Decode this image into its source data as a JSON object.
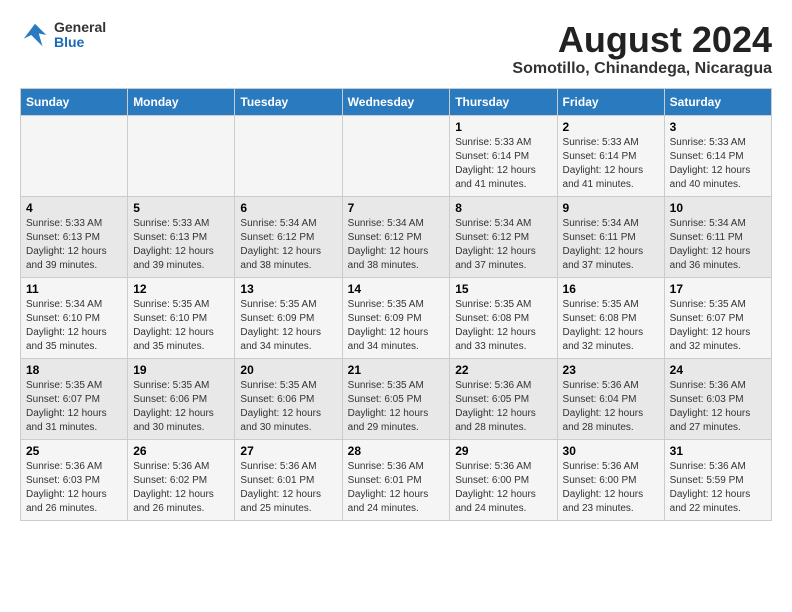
{
  "header": {
    "logo_general": "General",
    "logo_blue": "Blue",
    "month_title": "August 2024",
    "subtitle": "Somotillo, Chinandega, Nicaragua"
  },
  "weekdays": [
    "Sunday",
    "Monday",
    "Tuesday",
    "Wednesday",
    "Thursday",
    "Friday",
    "Saturday"
  ],
  "weeks": [
    [
      {
        "day": "",
        "info": ""
      },
      {
        "day": "",
        "info": ""
      },
      {
        "day": "",
        "info": ""
      },
      {
        "day": "",
        "info": ""
      },
      {
        "day": "1",
        "info": "Sunrise: 5:33 AM\nSunset: 6:14 PM\nDaylight: 12 hours\nand 41 minutes."
      },
      {
        "day": "2",
        "info": "Sunrise: 5:33 AM\nSunset: 6:14 PM\nDaylight: 12 hours\nand 41 minutes."
      },
      {
        "day": "3",
        "info": "Sunrise: 5:33 AM\nSunset: 6:14 PM\nDaylight: 12 hours\nand 40 minutes."
      }
    ],
    [
      {
        "day": "4",
        "info": "Sunrise: 5:33 AM\nSunset: 6:13 PM\nDaylight: 12 hours\nand 39 minutes."
      },
      {
        "day": "5",
        "info": "Sunrise: 5:33 AM\nSunset: 6:13 PM\nDaylight: 12 hours\nand 39 minutes."
      },
      {
        "day": "6",
        "info": "Sunrise: 5:34 AM\nSunset: 6:12 PM\nDaylight: 12 hours\nand 38 minutes."
      },
      {
        "day": "7",
        "info": "Sunrise: 5:34 AM\nSunset: 6:12 PM\nDaylight: 12 hours\nand 38 minutes."
      },
      {
        "day": "8",
        "info": "Sunrise: 5:34 AM\nSunset: 6:12 PM\nDaylight: 12 hours\nand 37 minutes."
      },
      {
        "day": "9",
        "info": "Sunrise: 5:34 AM\nSunset: 6:11 PM\nDaylight: 12 hours\nand 37 minutes."
      },
      {
        "day": "10",
        "info": "Sunrise: 5:34 AM\nSunset: 6:11 PM\nDaylight: 12 hours\nand 36 minutes."
      }
    ],
    [
      {
        "day": "11",
        "info": "Sunrise: 5:34 AM\nSunset: 6:10 PM\nDaylight: 12 hours\nand 35 minutes."
      },
      {
        "day": "12",
        "info": "Sunrise: 5:35 AM\nSunset: 6:10 PM\nDaylight: 12 hours\nand 35 minutes."
      },
      {
        "day": "13",
        "info": "Sunrise: 5:35 AM\nSunset: 6:09 PM\nDaylight: 12 hours\nand 34 minutes."
      },
      {
        "day": "14",
        "info": "Sunrise: 5:35 AM\nSunset: 6:09 PM\nDaylight: 12 hours\nand 34 minutes."
      },
      {
        "day": "15",
        "info": "Sunrise: 5:35 AM\nSunset: 6:08 PM\nDaylight: 12 hours\nand 33 minutes."
      },
      {
        "day": "16",
        "info": "Sunrise: 5:35 AM\nSunset: 6:08 PM\nDaylight: 12 hours\nand 32 minutes."
      },
      {
        "day": "17",
        "info": "Sunrise: 5:35 AM\nSunset: 6:07 PM\nDaylight: 12 hours\nand 32 minutes."
      }
    ],
    [
      {
        "day": "18",
        "info": "Sunrise: 5:35 AM\nSunset: 6:07 PM\nDaylight: 12 hours\nand 31 minutes."
      },
      {
        "day": "19",
        "info": "Sunrise: 5:35 AM\nSunset: 6:06 PM\nDaylight: 12 hours\nand 30 minutes."
      },
      {
        "day": "20",
        "info": "Sunrise: 5:35 AM\nSunset: 6:06 PM\nDaylight: 12 hours\nand 30 minutes."
      },
      {
        "day": "21",
        "info": "Sunrise: 5:35 AM\nSunset: 6:05 PM\nDaylight: 12 hours\nand 29 minutes."
      },
      {
        "day": "22",
        "info": "Sunrise: 5:36 AM\nSunset: 6:05 PM\nDaylight: 12 hours\nand 28 minutes."
      },
      {
        "day": "23",
        "info": "Sunrise: 5:36 AM\nSunset: 6:04 PM\nDaylight: 12 hours\nand 28 minutes."
      },
      {
        "day": "24",
        "info": "Sunrise: 5:36 AM\nSunset: 6:03 PM\nDaylight: 12 hours\nand 27 minutes."
      }
    ],
    [
      {
        "day": "25",
        "info": "Sunrise: 5:36 AM\nSunset: 6:03 PM\nDaylight: 12 hours\nand 26 minutes."
      },
      {
        "day": "26",
        "info": "Sunrise: 5:36 AM\nSunset: 6:02 PM\nDaylight: 12 hours\nand 26 minutes."
      },
      {
        "day": "27",
        "info": "Sunrise: 5:36 AM\nSunset: 6:01 PM\nDaylight: 12 hours\nand 25 minutes."
      },
      {
        "day": "28",
        "info": "Sunrise: 5:36 AM\nSunset: 6:01 PM\nDaylight: 12 hours\nand 24 minutes."
      },
      {
        "day": "29",
        "info": "Sunrise: 5:36 AM\nSunset: 6:00 PM\nDaylight: 12 hours\nand 24 minutes."
      },
      {
        "day": "30",
        "info": "Sunrise: 5:36 AM\nSunset: 6:00 PM\nDaylight: 12 hours\nand 23 minutes."
      },
      {
        "day": "31",
        "info": "Sunrise: 5:36 AM\nSunset: 5:59 PM\nDaylight: 12 hours\nand 22 minutes."
      }
    ]
  ]
}
